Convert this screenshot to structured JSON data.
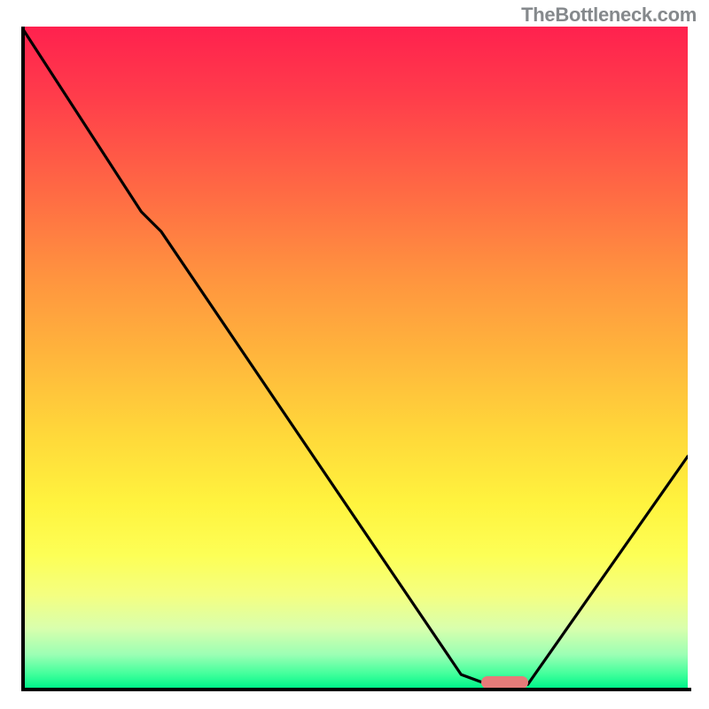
{
  "watermark": "TheBottleneck.com",
  "chart_data": {
    "type": "line",
    "title": "",
    "xlabel": "",
    "ylabel": "",
    "xlim": [
      0,
      100
    ],
    "ylim": [
      0,
      100
    ],
    "grid": false,
    "legend": false,
    "gradient_background": {
      "direction": "top-to-bottom",
      "stops": [
        {
          "pos": 0,
          "color": "#ff214e"
        },
        {
          "pos": 25,
          "color": "#ff6a44"
        },
        {
          "pos": 50,
          "color": "#ffb63c"
        },
        {
          "pos": 72,
          "color": "#fff33e"
        },
        {
          "pos": 86,
          "color": "#f4ff81"
        },
        {
          "pos": 100,
          "color": "#00f58a"
        }
      ]
    },
    "series": [
      {
        "name": "bottleneck-curve",
        "x": [
          0,
          18,
          21,
          66,
          70,
          76,
          100
        ],
        "values": [
          100,
          72,
          69,
          2,
          0.5,
          0.5,
          35
        ],
        "color": "#000000"
      }
    ],
    "marker": {
      "x_start": 69,
      "x_end": 76,
      "y": 0.8,
      "color": "#e67b79"
    }
  }
}
